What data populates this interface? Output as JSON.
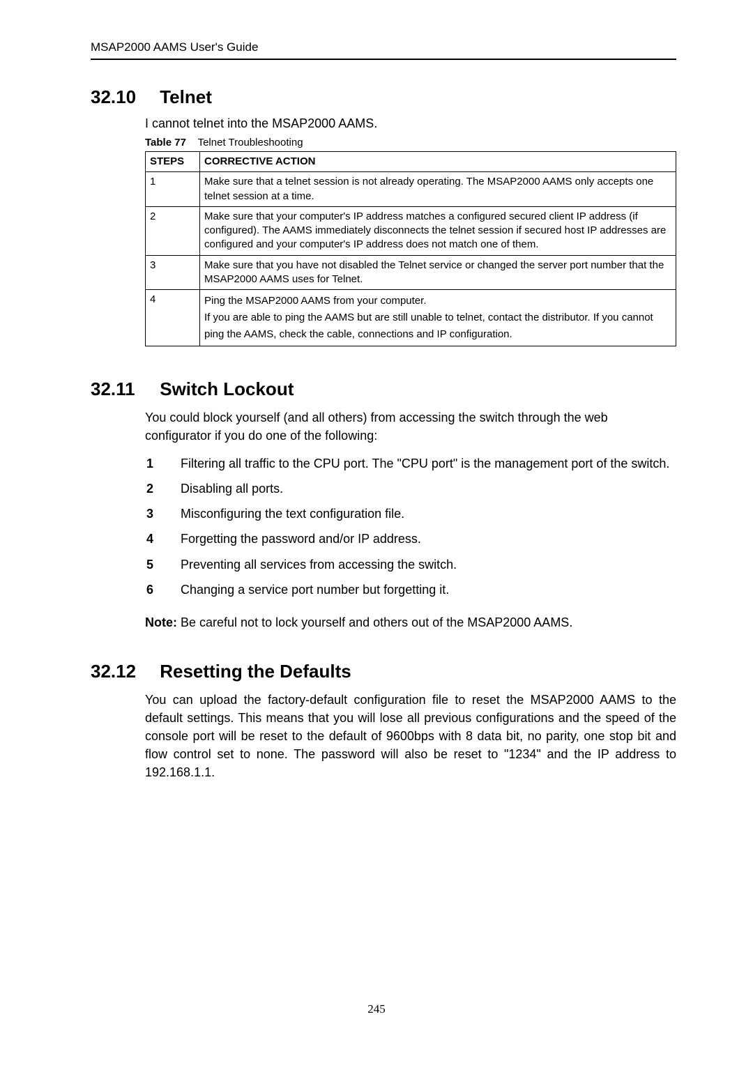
{
  "running_head": "MSAP2000 AAMS User's Guide",
  "sec1": {
    "num": "32.10",
    "title": "Telnet",
    "intro": "I cannot telnet into the MSAP2000 AAMS.",
    "table_label": "Table 77",
    "table_title": "Telnet Troubleshooting",
    "col_steps": "STEPS",
    "col_action": "CORRECTIVE ACTION",
    "rows": [
      {
        "step": "1",
        "action": "Make sure that a telnet session is not already operating. The MSAP2000 AAMS only accepts one telnet session at a time."
      },
      {
        "step": "2",
        "action": "Make sure that your computer's IP address matches a configured secured client IP address (if configured). The AAMS immediately disconnects the telnet session if secured host IP addresses are configured and your computer's IP address does not match one of them."
      },
      {
        "step": "3",
        "action": "Make sure that you have not disabled the Telnet service or changed the server port number that the MSAP2000 AAMS uses for Telnet."
      },
      {
        "step": "4",
        "action": "Ping the MSAP2000 AAMS from your computer.\nIf you are able to ping the AAMS but are still unable to telnet, contact the distributor. If you cannot ping the AAMS, check the cable, connections and IP configuration."
      }
    ]
  },
  "sec2": {
    "num": "32.11",
    "title": "Switch Lockout",
    "para": "You could block yourself (and all others) from accessing the switch through the web configurator if you do one of the following:",
    "items": [
      "Filtering all traffic to the CPU port. The \"CPU port\" is the management port of the switch.",
      "Disabling all ports.",
      "Misconfiguring the text configuration file.",
      "Forgetting the password and/or IP address.",
      "Preventing all services from accessing the switch.",
      "Changing a service port number but forgetting it."
    ],
    "note_label": "Note:",
    "note_text": " Be careful not to lock yourself and others out of the MSAP2000 AAMS."
  },
  "sec3": {
    "num": "32.12",
    "title": "Resetting the Defaults",
    "para": "You can upload the factory-default configuration file to reset the MSAP2000 AAMS to the default settings. This means that you will lose all previous configurations and the speed of the console port will be reset to the default of 9600bps with 8 data bit, no parity, one stop bit and flow control set to none. The password will also be reset to \"1234\" and the IP address to 192.168.1.1."
  },
  "page_number": "245"
}
